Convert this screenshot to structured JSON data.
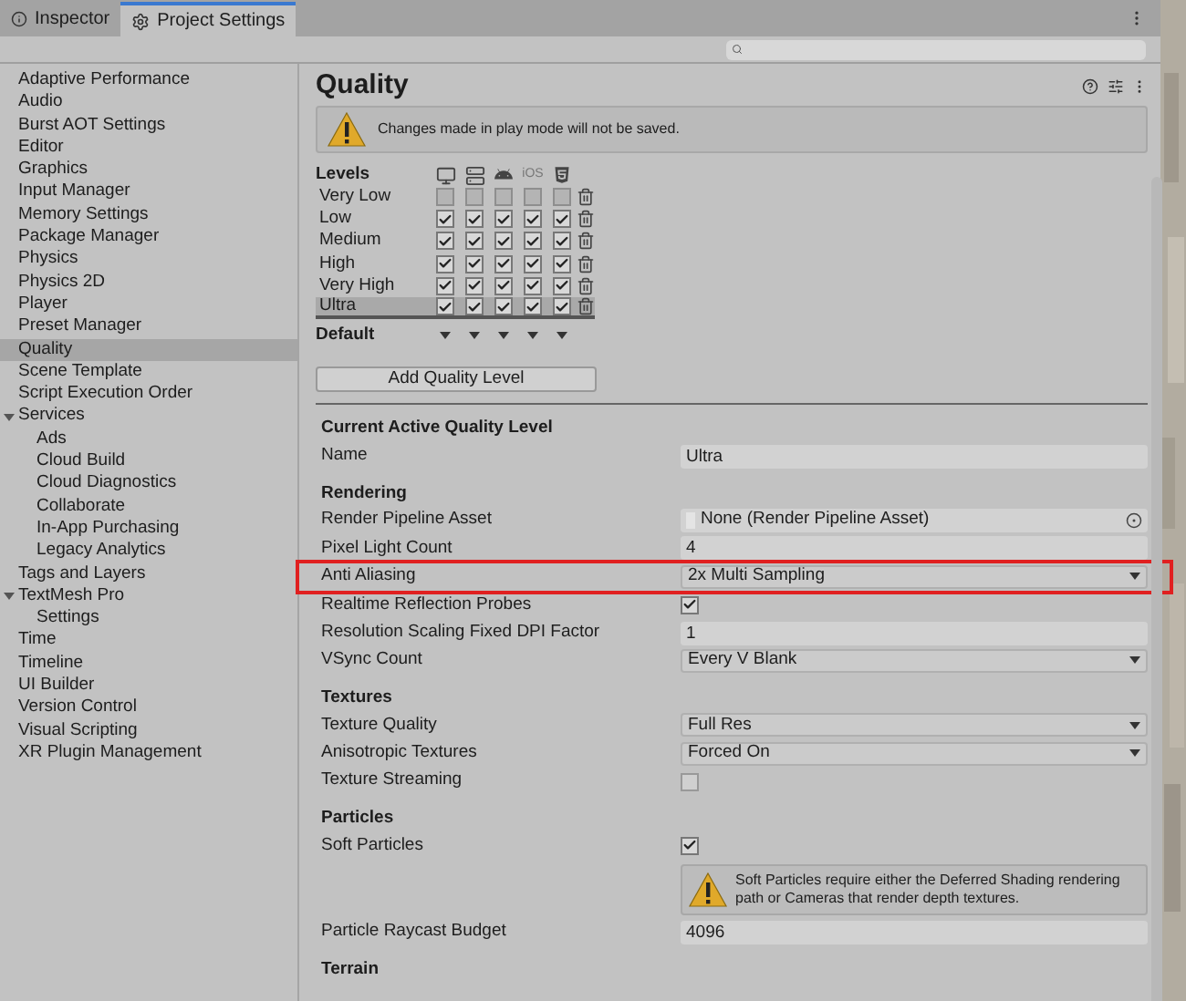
{
  "tabs": [
    {
      "label": "Inspector",
      "selected": false
    },
    {
      "label": "Project Settings",
      "selected": true
    }
  ],
  "sidebar": {
    "items": [
      {
        "label": "Adaptive Performance",
        "selected": false
      },
      {
        "label": "Audio",
        "selected": false
      },
      {
        "label": "Burst AOT Settings",
        "selected": false
      },
      {
        "label": "Editor",
        "selected": false
      },
      {
        "label": "Graphics",
        "selected": false
      },
      {
        "label": "Input Manager",
        "selected": false
      },
      {
        "label": "Memory Settings",
        "selected": false
      },
      {
        "label": "Package Manager",
        "selected": false
      },
      {
        "label": "Physics",
        "selected": false
      },
      {
        "label": "Physics 2D",
        "selected": false
      },
      {
        "label": "Player",
        "selected": false
      },
      {
        "label": "Preset Manager",
        "selected": false
      },
      {
        "label": "Quality",
        "selected": true
      },
      {
        "label": "Scene Template",
        "selected": false
      },
      {
        "label": "Script Execution Order",
        "selected": false
      },
      {
        "label": "Services",
        "selected": false,
        "expanded": true,
        "children": [
          {
            "label": "Ads",
            "selected": false
          },
          {
            "label": "Cloud Build",
            "selected": false
          },
          {
            "label": "Cloud Diagnostics",
            "selected": false
          },
          {
            "label": "Collaborate",
            "selected": false
          },
          {
            "label": "In-App Purchasing",
            "selected": false
          },
          {
            "label": "Legacy Analytics",
            "selected": false
          }
        ]
      },
      {
        "label": "Tags and Layers",
        "selected": false
      },
      {
        "label": "TextMesh Pro",
        "selected": false,
        "expanded": true,
        "children": [
          {
            "label": "Settings",
            "selected": false
          }
        ]
      },
      {
        "label": "Time",
        "selected": false
      },
      {
        "label": "Timeline",
        "selected": false
      },
      {
        "label": "UI Builder",
        "selected": false
      },
      {
        "label": "Version Control",
        "selected": false
      },
      {
        "label": "Visual Scripting",
        "selected": false
      },
      {
        "label": "XR Plugin Management",
        "selected": false
      }
    ]
  },
  "page": {
    "title": "Quality",
    "notice": "Changes made in play mode will not be saved.",
    "levels_label": "Levels",
    "platform_ios": "iOS",
    "levels": [
      {
        "name": "Very Low",
        "selected": false,
        "platforms": [
          false,
          false,
          false,
          false,
          false
        ]
      },
      {
        "name": "Low",
        "selected": false,
        "platforms": [
          true,
          true,
          true,
          true,
          true
        ]
      },
      {
        "name": "Medium",
        "selected": false,
        "platforms": [
          true,
          true,
          true,
          true,
          true
        ]
      },
      {
        "name": "High",
        "selected": false,
        "platforms": [
          true,
          true,
          true,
          true,
          true
        ]
      },
      {
        "name": "Very High",
        "selected": false,
        "platforms": [
          true,
          true,
          true,
          true,
          true
        ]
      },
      {
        "name": "Ultra",
        "selected": true,
        "platforms": [
          true,
          true,
          true,
          true,
          true
        ]
      }
    ],
    "default_label": "Default",
    "add_button": "Add Quality Level",
    "sections": [
      {
        "title": "Current Active Quality Level",
        "rows": [
          {
            "kind": "text",
            "label": "Name",
            "value": "Ultra",
            "highlighted": false
          }
        ]
      },
      {
        "title": "Rendering",
        "rows": [
          {
            "kind": "object",
            "label": "Render Pipeline Asset",
            "value": "None (Render Pipeline Asset)",
            "highlighted": false
          },
          {
            "kind": "text",
            "label": "Pixel Light Count",
            "value": "4",
            "highlighted": false
          },
          {
            "kind": "dropdown",
            "label": "Anti Aliasing",
            "value": "2x Multi Sampling",
            "highlighted": true
          },
          {
            "kind": "checkbox",
            "label": "Realtime Reflection Probes",
            "checked": true,
            "highlighted": false
          },
          {
            "kind": "text",
            "label": "Resolution Scaling Fixed DPI Factor",
            "value": "1",
            "highlighted": false
          },
          {
            "kind": "dropdown",
            "label": "VSync Count",
            "value": "Every V Blank",
            "highlighted": false
          }
        ]
      },
      {
        "title": "Textures",
        "rows": [
          {
            "kind": "dropdown",
            "label": "Texture Quality",
            "value": "Full Res",
            "highlighted": false
          },
          {
            "kind": "dropdown",
            "label": "Anisotropic Textures",
            "value": "Forced On",
            "highlighted": false
          },
          {
            "kind": "checkbox",
            "label": "Texture Streaming",
            "checked": false,
            "highlighted": false
          }
        ]
      },
      {
        "title": "Particles",
        "rows": [
          {
            "kind": "checkbox",
            "label": "Soft Particles",
            "checked": true,
            "highlighted": false
          },
          {
            "kind": "warning",
            "text": "Soft Particles require either the Deferred Shading rendering path or Cameras that render depth textures."
          },
          {
            "kind": "text",
            "label": "Particle Raycast Budget",
            "value": "4096",
            "highlighted": false
          }
        ]
      },
      {
        "title": "Terrain"
      }
    ]
  }
}
